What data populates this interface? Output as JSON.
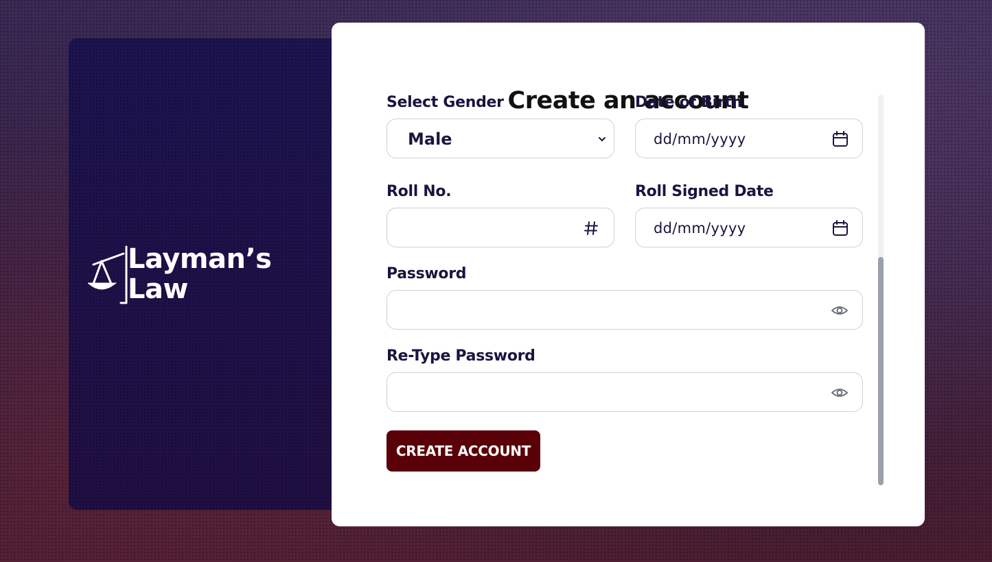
{
  "brand": {
    "name_line1": "Layman’s",
    "name_line2": "Law"
  },
  "form": {
    "title": "Create an account",
    "gender": {
      "label": "Select Gender",
      "value": "Male"
    },
    "dob": {
      "label": "Date of Birth",
      "placeholder": "dd/mm/yyyy"
    },
    "roll_no": {
      "label": "Roll No.",
      "value": ""
    },
    "roll_signed_date": {
      "label": "Roll Signed Date",
      "placeholder": "dd/mm/yyyy"
    },
    "password": {
      "label": "Password",
      "value": ""
    },
    "retype_password": {
      "label": "Re-Type Password",
      "value": ""
    },
    "submit_label": "CREATE ACCOUNT"
  },
  "icons": {
    "scale": "scales-of-justice-icon",
    "chevron": "chevron-down-icon",
    "calendar": "calendar-icon",
    "hash": "hash-icon",
    "eye": "eye-icon"
  },
  "colors": {
    "primary_text": "#1a1440",
    "button": "#5a0008",
    "brand_panel": "#1a1250"
  }
}
